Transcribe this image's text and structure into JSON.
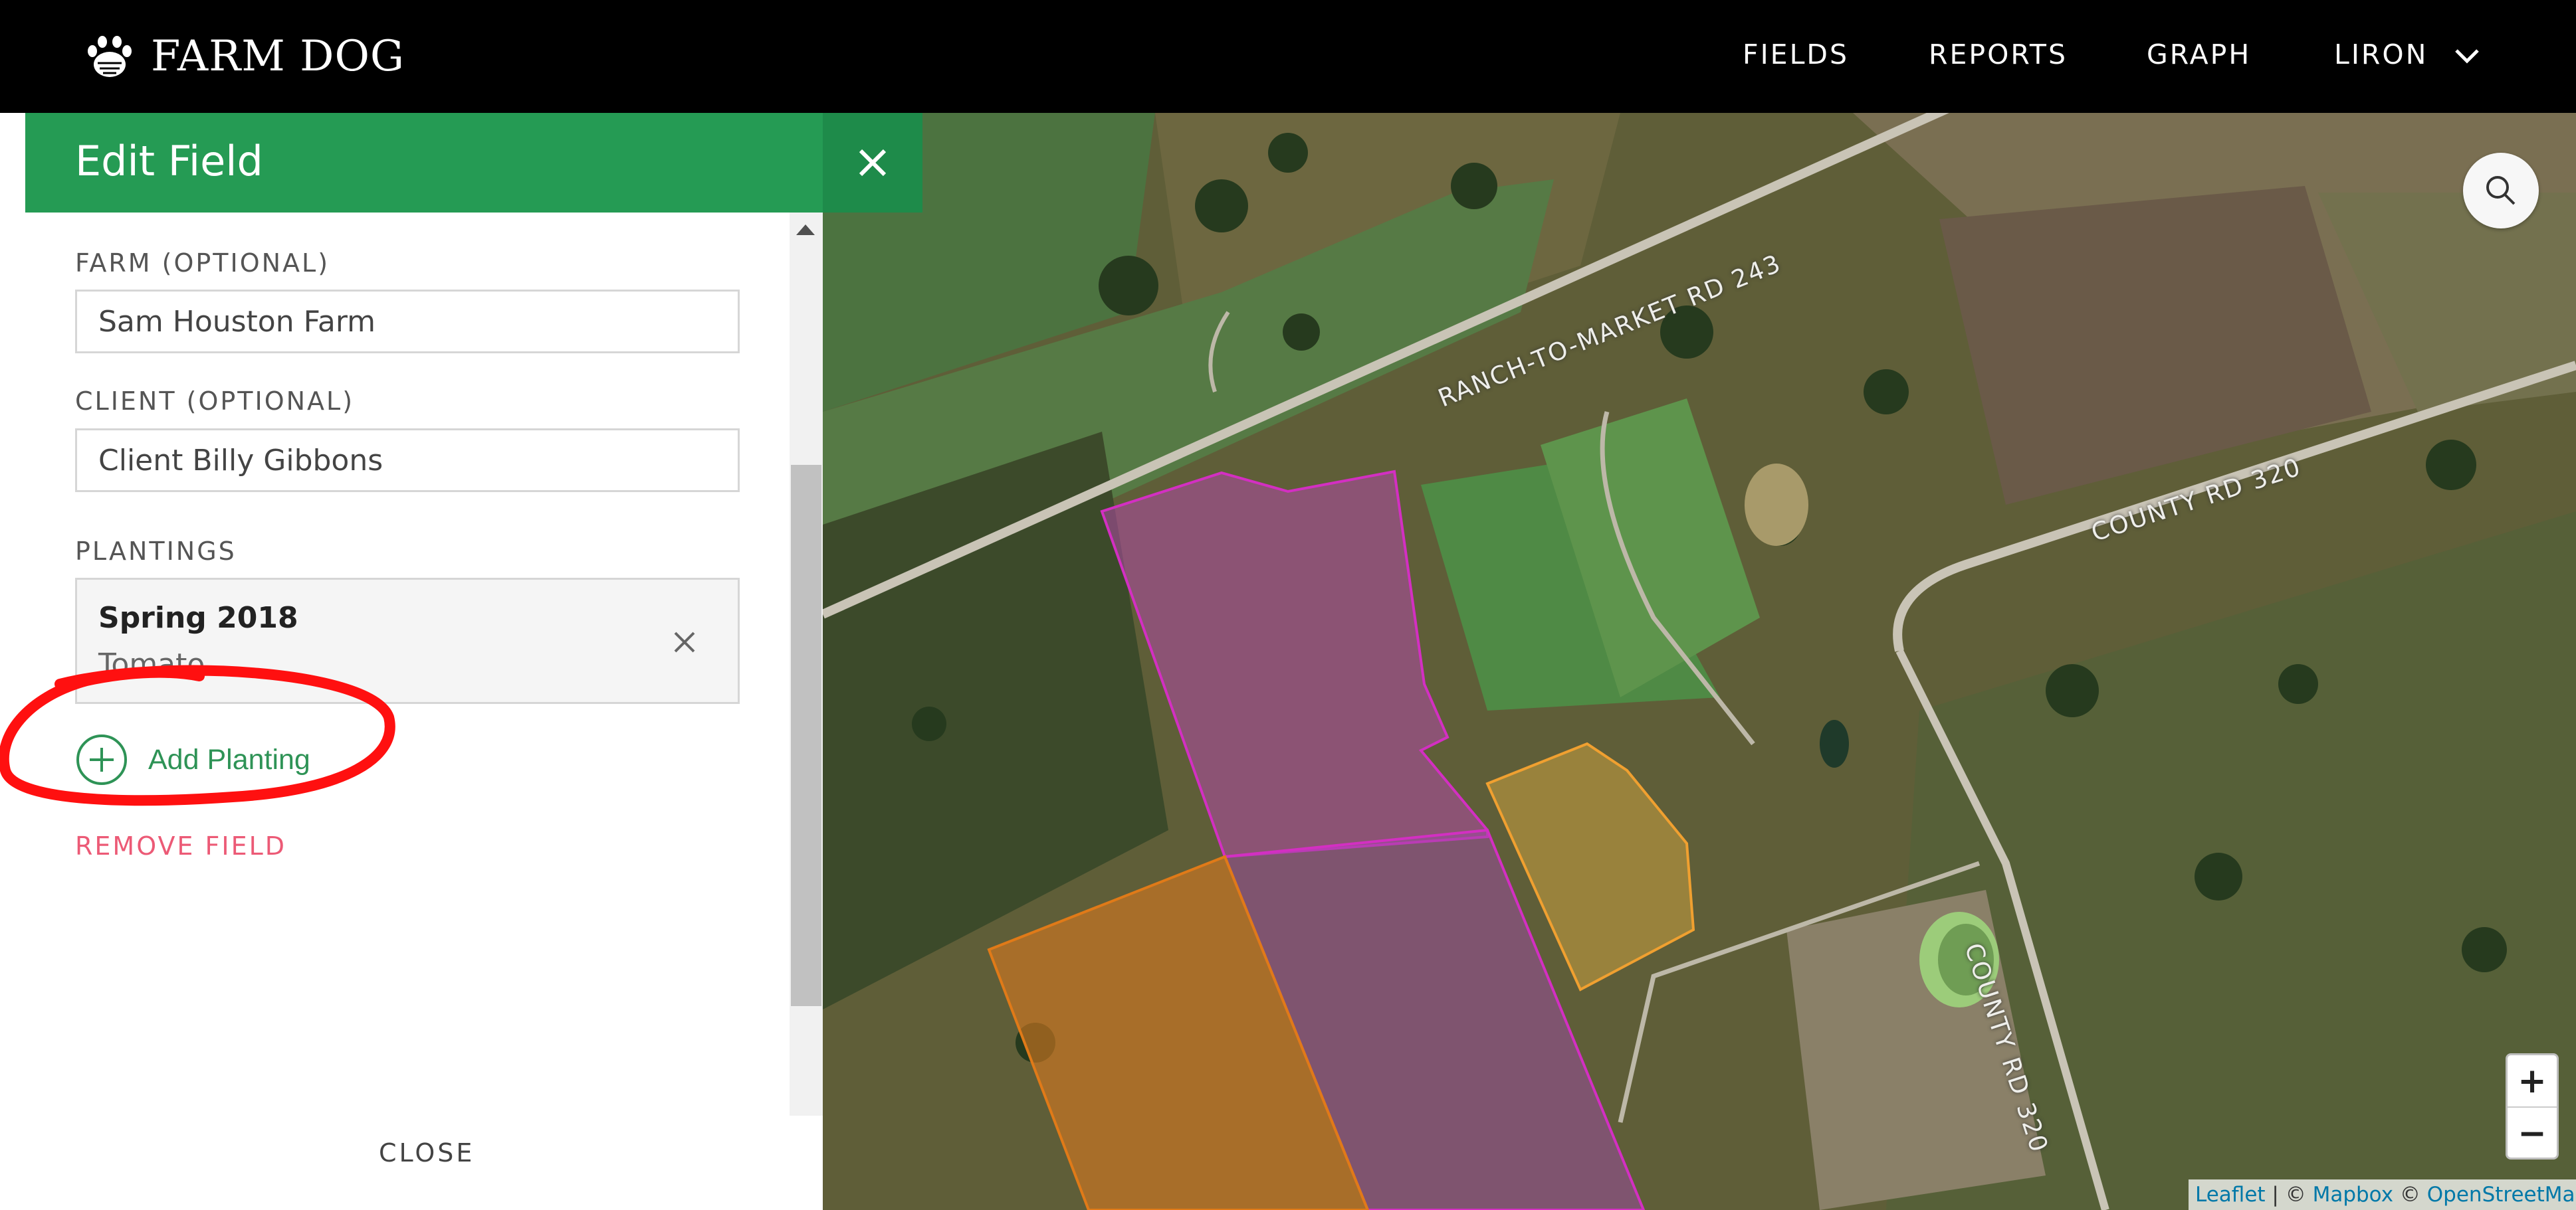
{
  "app": {
    "brand": "FARM DOG",
    "nav": [
      "FIELDS",
      "REPORTS",
      "GRAPH",
      "LIRON"
    ]
  },
  "panel": {
    "title": "Edit Field",
    "farm_label": "FARM (OPTIONAL)",
    "farm_value": "Sam Houston Farm",
    "client_label": "CLIENT (OPTIONAL)",
    "client_value": "Client Billy Gibbons",
    "plantings_label": "PLANTINGS",
    "plantings": [
      {
        "name": "Spring 2018",
        "crop": "Tomato"
      }
    ],
    "add_planting": "Add Planting",
    "remove_field": "REMOVE FIELD",
    "close": "CLOSE"
  },
  "map": {
    "road_labels": [
      "RANCH-TO-MARKET RD 243",
      "COUNTY RD 320",
      "COUNTY RD 320"
    ],
    "zoom_in": "+",
    "zoom_out": "−",
    "attribution": {
      "leaflet": "Leaflet",
      "sep1": " | © ",
      "mapbox": "Mapbox",
      "sep2": " © ",
      "osm": "OpenStreetMap"
    },
    "field_colors": {
      "selected": "#c41aa8",
      "other": "#e07a18",
      "small": "#f0a030"
    }
  },
  "annotation": {
    "color": "#ff1010"
  }
}
